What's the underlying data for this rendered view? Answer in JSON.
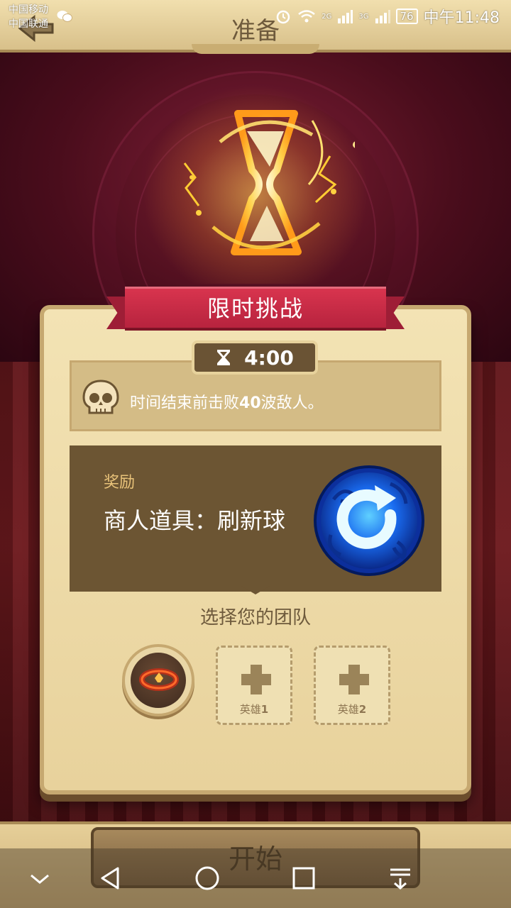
{
  "status_bar": {
    "carrier_1": "中国移动",
    "carrier_2": "中国联通",
    "network_2g": "2G",
    "network_3g": "3G",
    "battery": "76",
    "time": "中午11:48"
  },
  "header": {
    "title": "准备"
  },
  "challenge": {
    "ribbon_title": "限时挑战",
    "timer": "4:00",
    "objective_prefix": "时间结束前击败",
    "objective_count": "40",
    "objective_suffix": "波敌人。"
  },
  "reward": {
    "label": "奖励",
    "name": "商人道具：刷新球"
  },
  "team": {
    "title": "选择您的团队",
    "slots": [
      {
        "label_prefix": "英雄",
        "label_num": "1"
      },
      {
        "label_prefix": "英雄",
        "label_num": "2"
      }
    ]
  },
  "footer": {
    "start_label": "开始"
  },
  "colors": {
    "panel": "#f3e3b4",
    "ribbon": "#c82a45",
    "reward_bg": "#6c5533",
    "accent_gold": "#e9c37a",
    "orb_blue": "#1a6cf0"
  },
  "icons": [
    "back-icon",
    "wechat-icon",
    "hourglass-icon",
    "skull-icon",
    "refresh-orb-icon",
    "plus-icon",
    "chevron-down-icon",
    "nav-back-icon",
    "nav-home-icon",
    "nav-recent-icon",
    "nav-menu-icon"
  ]
}
